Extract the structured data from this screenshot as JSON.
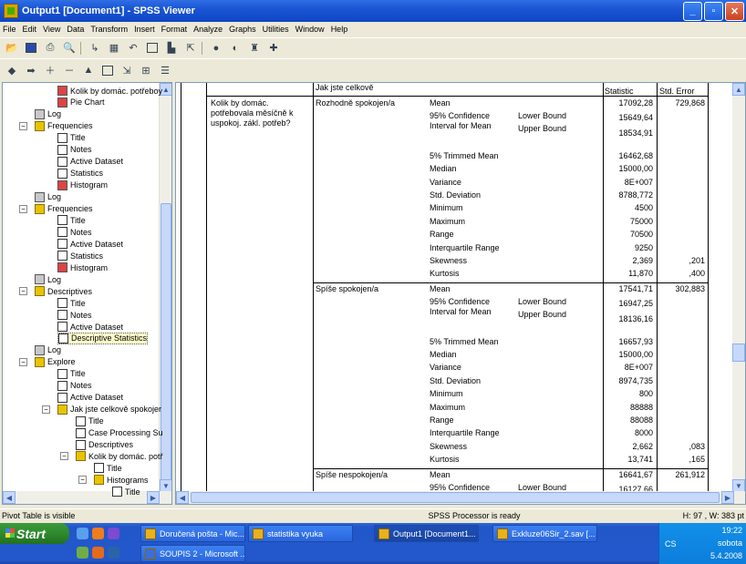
{
  "window": {
    "title": "Output1 [Document1] - SPSS Viewer"
  },
  "menu": [
    "File",
    "Edit",
    "View",
    "Data",
    "Transform",
    "Insert",
    "Format",
    "Analyze",
    "Graphs",
    "Utilities",
    "Window",
    "Help"
  ],
  "outline": {
    "items": [
      {
        "label": "Kolik by domác. potřeboy",
        "icon": "chart-icon"
      },
      {
        "label": "Pie Chart",
        "icon": "chart-icon"
      },
      {
        "label": "Log",
        "icon": "log-icon"
      },
      {
        "label": "Frequencies",
        "icon": "book-icon"
      },
      {
        "label": "Title",
        "icon": "title-icon"
      },
      {
        "label": "Notes",
        "icon": "notes-icon"
      },
      {
        "label": "Active Dataset",
        "icon": "notes-icon"
      },
      {
        "label": "Statistics",
        "icon": "table-icon"
      },
      {
        "label": "Histogram",
        "icon": "chart-icon"
      },
      {
        "label": "Log",
        "icon": "log-icon"
      },
      {
        "label": "Frequencies",
        "icon": "book-icon"
      },
      {
        "label": "Title",
        "icon": "title-icon"
      },
      {
        "label": "Notes",
        "icon": "notes-icon"
      },
      {
        "label": "Active Dataset",
        "icon": "notes-icon"
      },
      {
        "label": "Statistics",
        "icon": "table-icon"
      },
      {
        "label": "Histogram",
        "icon": "chart-icon"
      },
      {
        "label": "Log",
        "icon": "log-icon"
      },
      {
        "label": "Descriptives",
        "icon": "book-icon"
      },
      {
        "label": "Title",
        "icon": "title-icon"
      },
      {
        "label": "Notes",
        "icon": "notes-icon"
      },
      {
        "label": "Active Dataset",
        "icon": "notes-icon"
      },
      {
        "label": "Descriptive Statistics",
        "icon": "table-icon"
      },
      {
        "label": "Log",
        "icon": "log-icon"
      },
      {
        "label": "Explore",
        "icon": "book-icon"
      },
      {
        "label": "Title",
        "icon": "title-icon"
      },
      {
        "label": "Notes",
        "icon": "notes-icon"
      },
      {
        "label": "Active Dataset",
        "icon": "notes-icon"
      },
      {
        "label": "Jak jste celkově spokojer",
        "icon": "book-icon"
      },
      {
        "label": "Title",
        "icon": "title-icon"
      },
      {
        "label": "Case Processing Su",
        "icon": "table-icon"
      },
      {
        "label": "Descriptives",
        "icon": "table-icon"
      },
      {
        "label": "Kolik by domác. potř",
        "icon": "book-icon"
      },
      {
        "label": "Title",
        "icon": "title-icon"
      },
      {
        "label": "Histograms",
        "icon": "book-icon"
      },
      {
        "label": "Title",
        "icon": "title-icon"
      }
    ]
  },
  "table": {
    "header_group": "Jak jste celkově",
    "col_statistic": "Statistic",
    "col_stderr": "Std. Error",
    "row_variable": "Kolik by domác. potřebovala měsíčně k uspokoj. zákl. potřeb?",
    "groups": [
      {
        "name": "Rozhodně spokojen/a",
        "rows": [
          {
            "stat": "Mean",
            "sub": "",
            "value": "17092,28",
            "se": "729,868"
          },
          {
            "stat": "95% Confidence Interval for Mean",
            "sub": "Lower Bound",
            "value": "15649,64",
            "se": ""
          },
          {
            "stat": "",
            "sub": "Upper Bound",
            "value": "18534,91",
            "se": ""
          },
          {
            "stat": "5% Trimmed Mean",
            "sub": "",
            "value": "16462,68",
            "se": ""
          },
          {
            "stat": "Median",
            "sub": "",
            "value": "15000,00",
            "se": ""
          },
          {
            "stat": "Variance",
            "sub": "",
            "value": "8E+007",
            "se": ""
          },
          {
            "stat": "Std. Deviation",
            "sub": "",
            "value": "8788,772",
            "se": ""
          },
          {
            "stat": "Minimum",
            "sub": "",
            "value": "4500",
            "se": ""
          },
          {
            "stat": "Maximum",
            "sub": "",
            "value": "75000",
            "se": ""
          },
          {
            "stat": "Range",
            "sub": "",
            "value": "70500",
            "se": ""
          },
          {
            "stat": "Interquartile Range",
            "sub": "",
            "value": "9250",
            "se": ""
          },
          {
            "stat": "Skewness",
            "sub": "",
            "value": "2,369",
            "se": ",201"
          },
          {
            "stat": "Kurtosis",
            "sub": "",
            "value": "11,870",
            "se": ",400"
          }
        ]
      },
      {
        "name": "Spíše spokojen/a",
        "rows": [
          {
            "stat": "Mean",
            "sub": "",
            "value": "17541,71",
            "se": "302,883"
          },
          {
            "stat": "95% Confidence Interval for Mean",
            "sub": "Lower Bound",
            "value": "16947,25",
            "se": ""
          },
          {
            "stat": "",
            "sub": "Upper Bound",
            "value": "18136,16",
            "se": ""
          },
          {
            "stat": "5% Trimmed Mean",
            "sub": "",
            "value": "16657,93",
            "se": ""
          },
          {
            "stat": "Median",
            "sub": "",
            "value": "15000,00",
            "se": ""
          },
          {
            "stat": "Variance",
            "sub": "",
            "value": "8E+007",
            "se": ""
          },
          {
            "stat": "Std. Deviation",
            "sub": "",
            "value": "8974,735",
            "se": ""
          },
          {
            "stat": "Minimum",
            "sub": "",
            "value": "800",
            "se": ""
          },
          {
            "stat": "Maximum",
            "sub": "",
            "value": "88888",
            "se": ""
          },
          {
            "stat": "Range",
            "sub": "",
            "value": "88088",
            "se": ""
          },
          {
            "stat": "Interquartile Range",
            "sub": "",
            "value": "8000",
            "se": ""
          },
          {
            "stat": "Skewness",
            "sub": "",
            "value": "2,662",
            "se": ",083"
          },
          {
            "stat": "Kurtosis",
            "sub": "",
            "value": "13,741",
            "se": ",165"
          }
        ]
      },
      {
        "name": "Spíše nespokojen/a",
        "rows": [
          {
            "stat": "Mean",
            "sub": "",
            "value": "16641,67",
            "se": "261,912"
          },
          {
            "stat": "95% Confidence Interval for Mean",
            "sub": "Lower Bound",
            "value": "16127,66",
            "se": ""
          }
        ]
      }
    ]
  },
  "status": {
    "left": "Pivot Table is visible",
    "center": "SPSS Processor  is ready",
    "right": "H: 97 , W: 383 pt"
  },
  "taskbar": {
    "start": "Start",
    "tasks_top": [
      "Doručená pošta - Mic...",
      "statistika vyuka",
      "Output1 [Document1...",
      "Exkluze06Sir_2.sav [..."
    ],
    "tasks_bottom": [
      "SOUPIS 2 - Microsoft ..."
    ],
    "tray": {
      "lang": "CS",
      "time": "19:22",
      "day": "sobota",
      "date": "5.4.2008"
    }
  }
}
